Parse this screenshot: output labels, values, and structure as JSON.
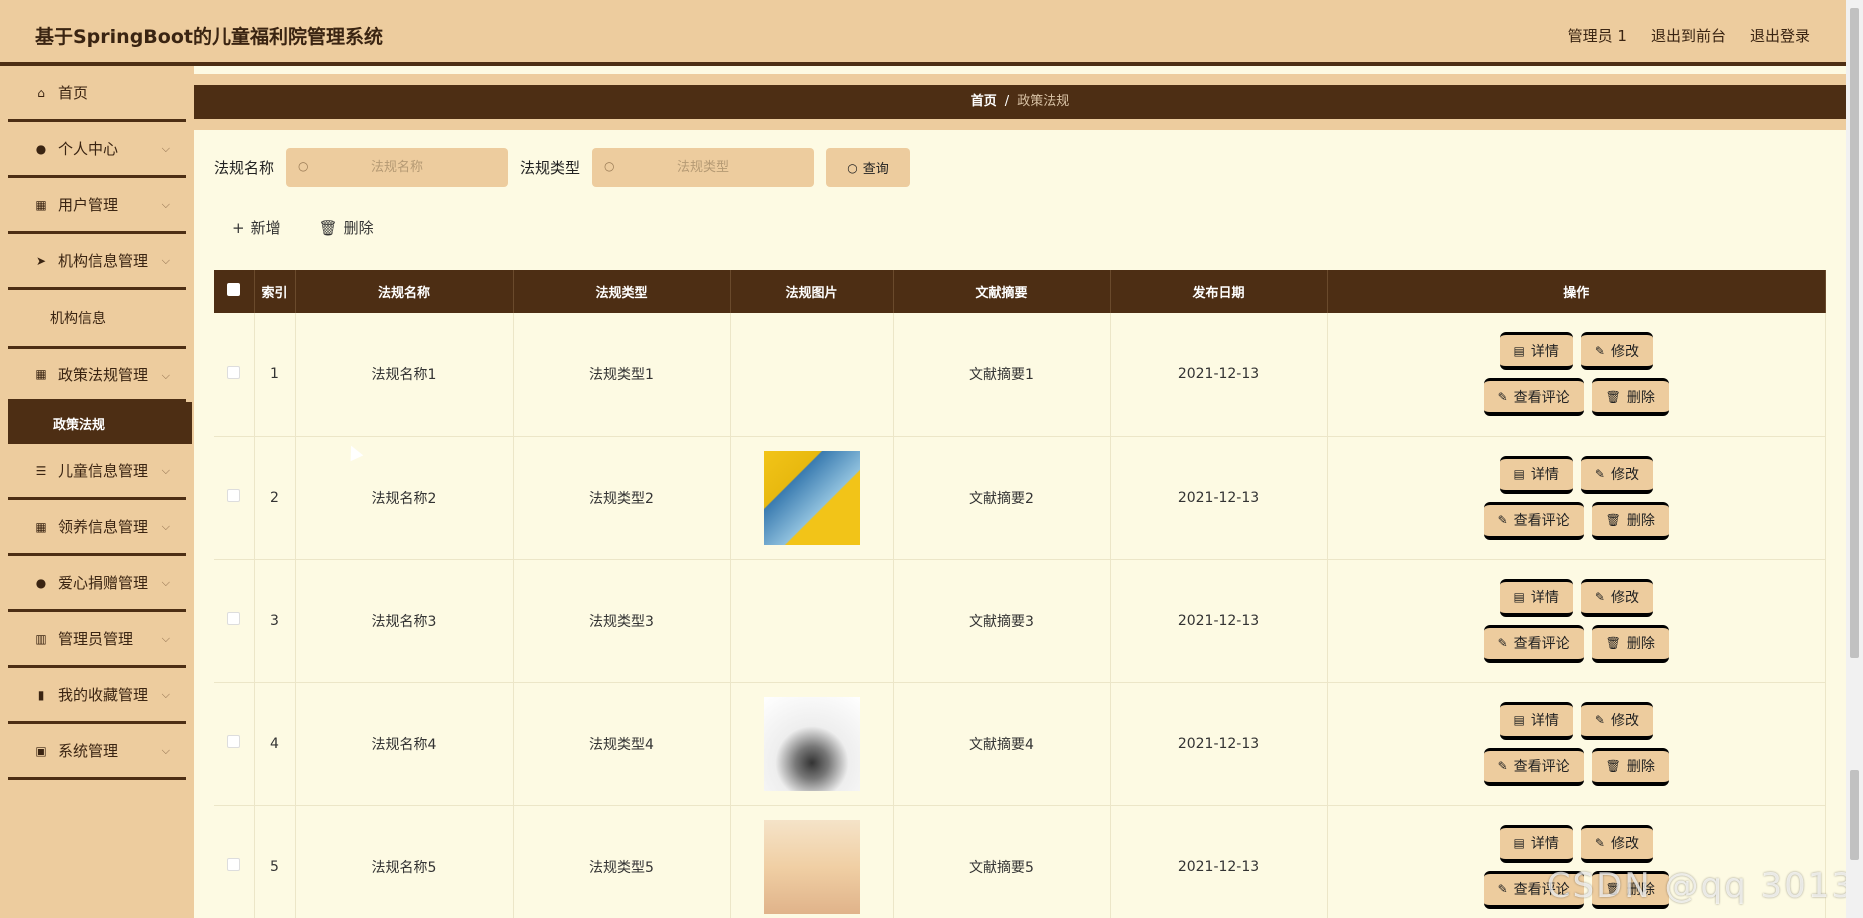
{
  "app": {
    "title": "基于SpringBoot的儿童福利院管理系统"
  },
  "header_links": [
    {
      "label": "管理员 1"
    },
    {
      "label": "退出到前台"
    },
    {
      "label": "退出登录"
    }
  ],
  "sidebar": {
    "items": [
      {
        "label": "首页",
        "icon": "home-icon"
      },
      {
        "label": "个人中心",
        "icon": "user-icon"
      },
      {
        "label": "用户管理",
        "icon": "grid-icon"
      },
      {
        "label": "机构信息管理",
        "icon": "send-icon"
      },
      {
        "sub_label": "机构信息"
      },
      {
        "label": "政策法规管理",
        "icon": "grid-icon"
      },
      {
        "sub_label": "政策法规"
      },
      {
        "label": "儿童信息管理",
        "icon": "list-icon"
      },
      {
        "label": "领养信息管理",
        "icon": "grid-icon"
      },
      {
        "label": "爱心捐赠管理",
        "icon": "user-icon"
      },
      {
        "label": "管理员管理",
        "icon": "bars-icon"
      },
      {
        "label": "我的收藏管理",
        "icon": "chart-icon"
      },
      {
        "label": "系统管理",
        "icon": "clipboard-icon"
      }
    ]
  },
  "breadcrumb": {
    "home": "首页",
    "separator": "/",
    "current": "政策法规"
  },
  "search": {
    "name_label": "法规名称",
    "name_placeholder": "法规名称",
    "type_label": "法规类型",
    "type_placeholder": "法规类型",
    "query_label": "查询"
  },
  "actions": {
    "add_label": "新增",
    "delete_label": "删除"
  },
  "table": {
    "columns": [
      "索引",
      "法规名称",
      "法规类型",
      "法规图片",
      "文献摘要",
      "发布日期",
      "操作"
    ],
    "rows": [
      {
        "index": "1",
        "name": "法规名称1",
        "type": "法规类型1",
        "has_image": false,
        "summary": "文献摘要1",
        "date": "2021-12-13"
      },
      {
        "index": "2",
        "name": "法规名称2",
        "type": "法规类型2",
        "has_image": true,
        "summary": "文献摘要2",
        "date": "2021-12-13"
      },
      {
        "index": "3",
        "name": "法规名称3",
        "type": "法规类型3",
        "has_image": false,
        "summary": "文献摘要3",
        "date": "2021-12-13"
      },
      {
        "index": "4",
        "name": "法规名称4",
        "type": "法规类型4",
        "has_image": true,
        "summary": "文献摘要4",
        "date": "2021-12-13"
      },
      {
        "index": "5",
        "name": "法规名称5",
        "type": "法规类型5",
        "has_image": true,
        "summary": "文献摘要5",
        "date": "2021-12-13"
      }
    ],
    "op_labels": {
      "detail": "详情",
      "edit": "修改",
      "comments": "查看评论",
      "delete": "删除"
    }
  },
  "watermark": "CSDN @qq 3013",
  "colors": {
    "accent": "#4d2e14",
    "panel": "#edcc9e",
    "background": "#fdfae3"
  }
}
